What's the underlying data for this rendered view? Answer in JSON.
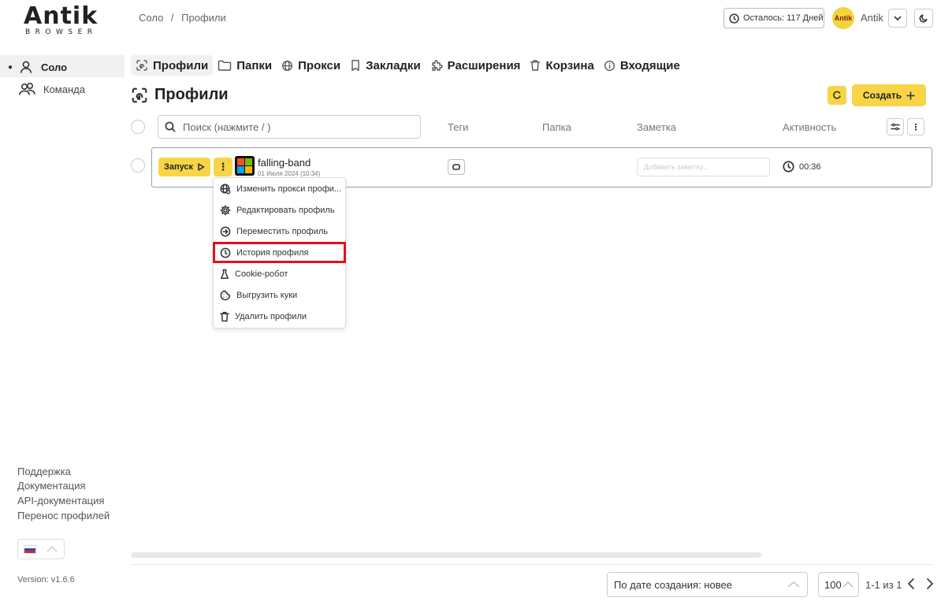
{
  "brand": {
    "logo": "Antik",
    "sub": "BROWSER"
  },
  "breadcrumb": {
    "first": "Соло",
    "sep": "/",
    "second": "Профили"
  },
  "topbar": {
    "days_left": "Осталось: 117 Дней",
    "avatar_text": "Antik",
    "username": "Antik"
  },
  "sidebar": {
    "items": [
      {
        "label": "Соло",
        "active": true,
        "icon": "user-icon"
      },
      {
        "label": "Команда",
        "active": false,
        "icon": "team-icon"
      }
    ],
    "links": [
      "Поддержка",
      "Документация",
      "API-документация",
      "Перенос профилей"
    ],
    "language": "ru",
    "version": "Version: v1.6.6"
  },
  "tabs": [
    {
      "label": "Профили",
      "icon": "fingerprint-icon",
      "active": true
    },
    {
      "label": "Папки",
      "icon": "folder-icon"
    },
    {
      "label": "Прокси",
      "icon": "globe-icon"
    },
    {
      "label": "Закладки",
      "icon": "bookmark-icon"
    },
    {
      "label": "Расширения",
      "icon": "puzzle-icon"
    },
    {
      "label": "Корзина",
      "icon": "trash-icon"
    },
    {
      "label": "Входящие",
      "icon": "info-icon"
    }
  ],
  "page": {
    "title": "Профили",
    "create_label": "Создать"
  },
  "table": {
    "search_placeholder": "Поиск (нажмите / )",
    "columns": {
      "tags": "Теги",
      "folder": "Папка",
      "note": "Заметка",
      "activity": "Активность"
    },
    "rows": [
      {
        "launch_label": "Запуск",
        "name": "falling-band",
        "created": "01 Июля 2024 (10:34)",
        "note_placeholder": "Добавить заметку...",
        "activity": "00:36"
      }
    ]
  },
  "context_menu": {
    "items": [
      {
        "label": "Изменить прокси профи...",
        "icon": "globe-settings-icon"
      },
      {
        "label": "Редактировать профиль",
        "icon": "gear-icon"
      },
      {
        "label": "Переместить профиль",
        "icon": "arrow-right-circle-icon"
      },
      {
        "label": "История профиля",
        "icon": "history-icon",
        "highlighted": true
      },
      {
        "label": "Cookie-робот",
        "icon": "flask-icon"
      },
      {
        "label": "Выгрузить куки",
        "icon": "cookie-icon"
      },
      {
        "label": "Удалить профили",
        "icon": "trash-icon"
      }
    ]
  },
  "footer": {
    "sort_label": "По дате создания: новее",
    "per_page": "100",
    "page_info": "1-1 из 1"
  },
  "colors": {
    "accent": "#f7d547",
    "highlight": "#e3101e"
  }
}
